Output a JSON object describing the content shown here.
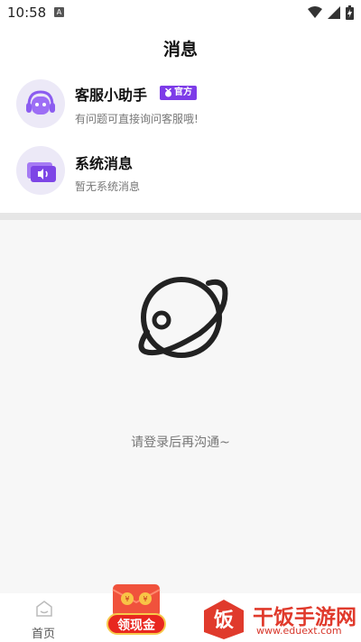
{
  "status_bar": {
    "time": "10:58",
    "notification_letter": "A"
  },
  "header": {
    "title": "消息"
  },
  "messages": [
    {
      "title": "客服小助手",
      "subtitle": "有问题可直接询问客服哦!",
      "badge": "官方",
      "avatar_icon": "robot-headset-icon"
    },
    {
      "title": "系统消息",
      "subtitle": "暂无系统消息",
      "avatar_icon": "speaker-monitor-icon"
    }
  ],
  "empty_state": {
    "icon": "planet-icon",
    "text": "请登录后再沟通~"
  },
  "bottom_nav": {
    "home_label": "首页",
    "cash_label": "领现金"
  },
  "watermark": {
    "brand": "干饭手游网",
    "url": "www.eduext.com",
    "seal_char": "饭"
  },
  "colors": {
    "accent": "#7d3ce8",
    "badge_bg": "#7d3ce8",
    "cash_red": "#e8271f",
    "watermark_red": "#e03a2c"
  }
}
